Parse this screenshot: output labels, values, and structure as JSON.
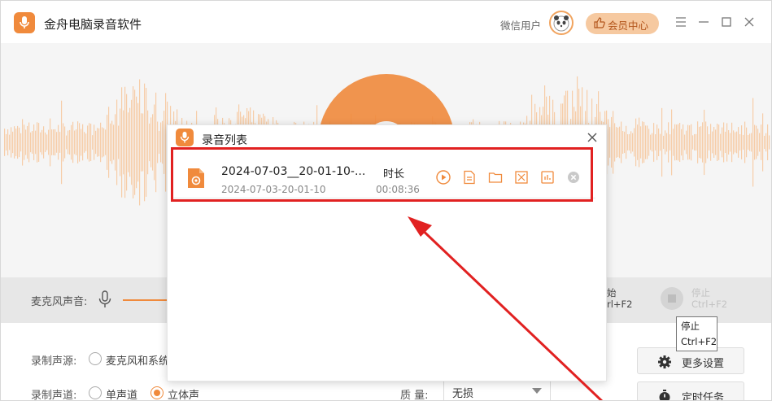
{
  "app": {
    "title": "金舟电脑录音软件",
    "user_name": "微信用户",
    "vip_label": "会员中心"
  },
  "control_bar": {
    "mic_label": "麦克风声音:",
    "start_partial_line1": "始",
    "start_partial_line2": "rl+F2",
    "stop_line1": "停止",
    "stop_line2": "Ctrl+F2"
  },
  "tooltip": {
    "line1": "停止",
    "line2": "Ctrl+F2"
  },
  "settings": {
    "source_label": "录制声源:",
    "source_option": "麦克风和系统",
    "channel_label": "录制声道:",
    "channel_mono": "单声道",
    "channel_stereo": "立体声",
    "quality_label": "质  量:",
    "quality_value": "无损",
    "more_settings": "更多设置",
    "timer_task": "定时任务"
  },
  "dialog": {
    "title": "录音列表",
    "records": [
      {
        "name": "2024-07-03__20-01-10-...",
        "date": "2024-07-03-20-01-10",
        "duration_title": "时长",
        "duration": "00:08:36"
      }
    ]
  },
  "colors": {
    "accent": "#f08a3c",
    "highlight": "#e12121"
  }
}
